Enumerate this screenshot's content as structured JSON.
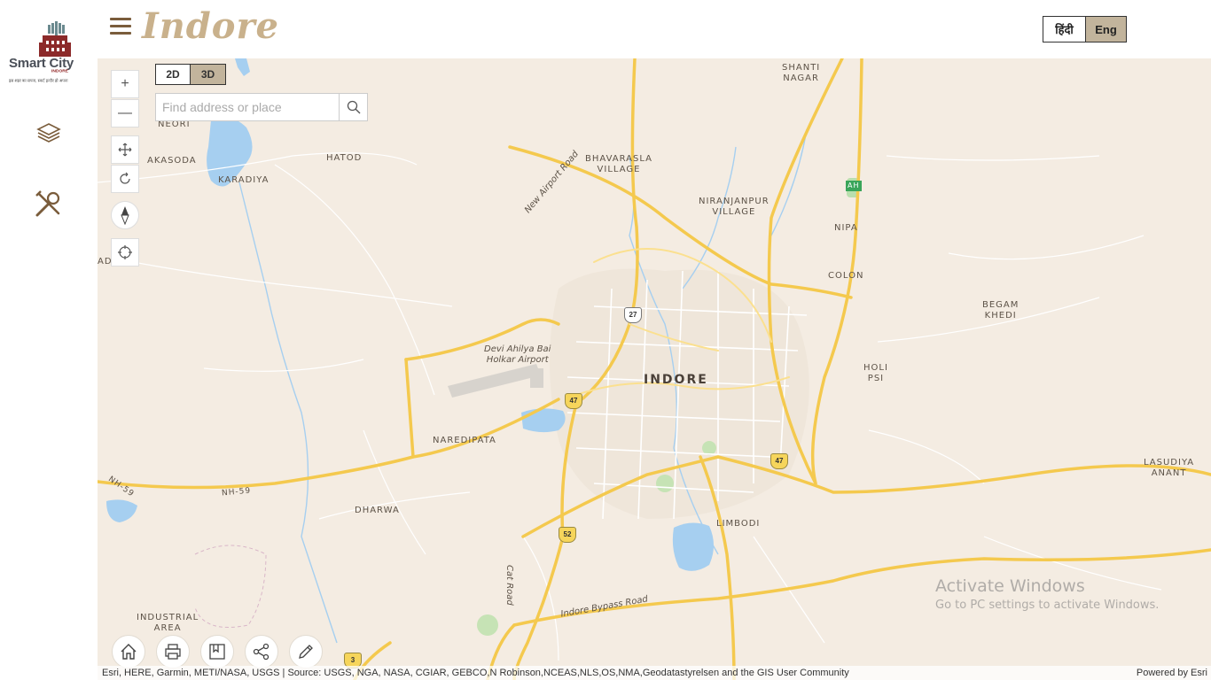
{
  "header": {
    "title": "Indore",
    "lang_hindi": "हिंदी",
    "lang_english": "Eng"
  },
  "logo": {
    "name": "Smart City",
    "sub": "INDORE",
    "tagline": "इस शहर का सपना, स्मार्ट इन्दौर हो अपना"
  },
  "sidebar": {
    "items": [
      {
        "icon": "layers-icon"
      },
      {
        "icon": "tools-icon"
      }
    ]
  },
  "map_controls": {
    "view_2d": "2D",
    "view_3d": "3D",
    "search_placeholder": "Find address or place",
    "zoom_in": "+",
    "zoom_out": "—"
  },
  "map": {
    "labels": {
      "shanti_nagar": "SHANTI\nNAGAR",
      "neori": "NEORI",
      "akasoda": "AKASODA",
      "hatod": "HATOD",
      "karadiya": "KARADIYA",
      "ad": "AD",
      "bhavarasla": "BHAVARASLA\nVILLAGE",
      "niranjanpur": "NIRANJANPUR\nVILLAGE",
      "nipa": "NIPA",
      "colon": "COLON",
      "begam_khedi": "BEGAM\nKHEDI",
      "holi_psi": "HOLI\nPSI",
      "indore": "INDORE",
      "airport": "Devi Ahilya Bai\nHolkar Airport",
      "naredipata": "NAREDIPATA",
      "dharwa": "DHARWA",
      "limbodi": "LIMBODI",
      "lasudiya": "LASUDIYA\nANANT",
      "industrial": "INDUSTRIAL\nAREA",
      "new_airport_road": "New Airport Road",
      "nh59": "NH-59",
      "nh59b": "NH-59",
      "cat_road": "Cat Road",
      "bypass": "Indore Bypass Road",
      "ah": "AH"
    },
    "shields": [
      "27",
      "47",
      "47",
      "52",
      "3"
    ],
    "attribution": "Esri, HERE, Garmin, METI/NASA, USGS | Source: USGS, NGA, NASA, CGIAR, GEBCO,N Robinson,NCEAS,NLS,OS,NMA,Geodatastyrelsen and the GIS User Community",
    "powered_by": "Powered by Esri"
  },
  "bottom_tools": [
    {
      "icon": "home-icon"
    },
    {
      "icon": "print-icon"
    },
    {
      "icon": "bookmark-icon"
    },
    {
      "icon": "share-icon"
    },
    {
      "icon": "draw-icon"
    }
  ],
  "watermark": {
    "title": "Activate Windows",
    "subtitle": "Go to PC settings to activate Windows."
  }
}
